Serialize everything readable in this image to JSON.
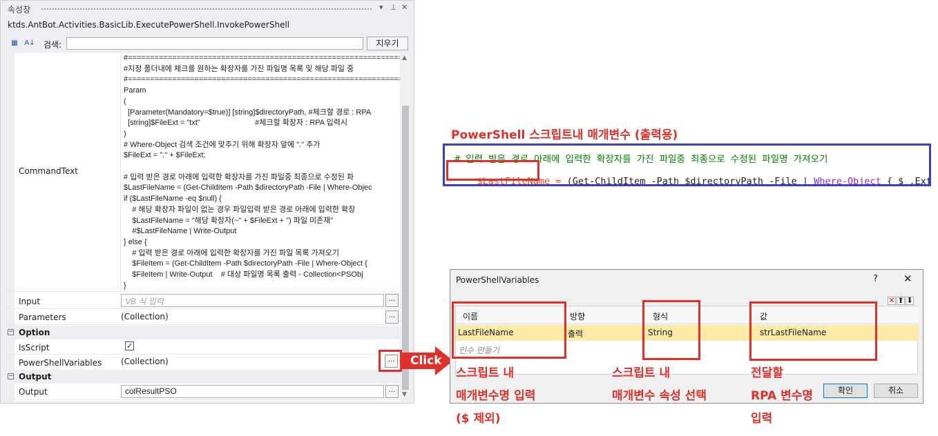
{
  "panel": {
    "title": "속성창",
    "pin_icon": "pin-icon",
    "close_icon": "close-icon",
    "class_name": "ktds.AntBot.Activities.BasicLib.ExecutePowerShell.InvokePowerShell",
    "search_label": "검색:",
    "search_value": "",
    "clear_label": "지우기",
    "command_label": "CommandText",
    "code_lines": [
      "#=========================================================================",
      "#지정 폴더내에 체크를 원하는 확장자를 가진 파일명 목록 및 해당 파일 중",
      "#=========================================================================",
      "Param",
      "(",
      "  [Parameter(Mandatory=$true)] [string]$directoryPath, #체크할 경로 : RPA",
      "  [string]$FileExt = \"txt\"                          #체크할 확장자 : RPA 입력시",
      ")",
      "# Where-Object 검색 조건에 맞추기 위해 확장자 앞에 \".\" 추가",
      "$FileExt = \".\" + $FileExt;",
      "",
      "# 입력 받은 경로 아래에 입력한 확장자를 가진 파일중 최종으로 수정된 파",
      "$LastFileName = (Get-ChildItem -Path $directoryPath -File | Where-Objec",
      "if ($LastFileName -eq $null) {",
      "    # 해당 확장자 파일이 없는 경우 파일입력 받은 경로 아래에 입력한 확장",
      "    $LastFileName = \"해당 확장자(~\" + $FileExt + \") 파일 미존재\"",
      "    #$LastFileName | Write-Output",
      "} else {",
      "    # 입력 받은 경로 아래에 입력한 확장자를 가진 파일 목록 가져오기",
      "    $FileItem = (Get-ChildItem -Path $directoryPath -File | Where-Object {",
      "    $FileItem | Write-Output    # 대상 파일명 목록 출력 - Collection<PSObj",
      "}"
    ],
    "input_label": "Input",
    "input_placeholder": "VB 식 입력",
    "parameters_label": "Parameters",
    "parameters_value": "(Collection)",
    "option_category": "Option",
    "isscript_label": "IsScript",
    "isscript_checked": true,
    "psvars_label": "PowerShellVariables",
    "psvars_value": "(Collection)",
    "output_category": "Output",
    "output_label": "Output",
    "output_value": "colResultPSO",
    "dots": "..."
  },
  "annotation": {
    "title": "PowerShell 스크립트내 매개변수 (출력용)",
    "code_line1": "# 입력 받은 경로 아래에 입력한 확장자를 가진 파일중 최종으로 수정된 파일명 가져오기",
    "code_var": "$LastFileName =",
    "code_line2_a": " (Get-ChildItem -Path $directoryPath -File | ",
    "code_line2_where": "Where-Object",
    "code_line2_b": " { $_.Extension",
    "click": "Click",
    "note_name_1": "스크립트 내",
    "note_name_2": "매개변수명 입력",
    "note_name_3": "($ 제외)",
    "note_type_1": "스크립트 내",
    "note_type_2": "매개변수 속성 선택",
    "note_value_1": "전달할",
    "note_value_2": "RPA 변수명",
    "note_value_3": "입력",
    "accent_red": "#e0302c",
    "accent_blue": "#3a3fbf"
  },
  "dialog": {
    "title": "PowerShellVariables",
    "help": "?",
    "close": "✕",
    "columns": [
      "이름",
      "방향",
      "형식",
      "값"
    ],
    "row": {
      "name": "LastFileName",
      "direction": "출력",
      "type": "String",
      "value": "strLastFileName"
    },
    "new_row": "인수 만들기",
    "ok": "확인",
    "cancel": "취소"
  }
}
